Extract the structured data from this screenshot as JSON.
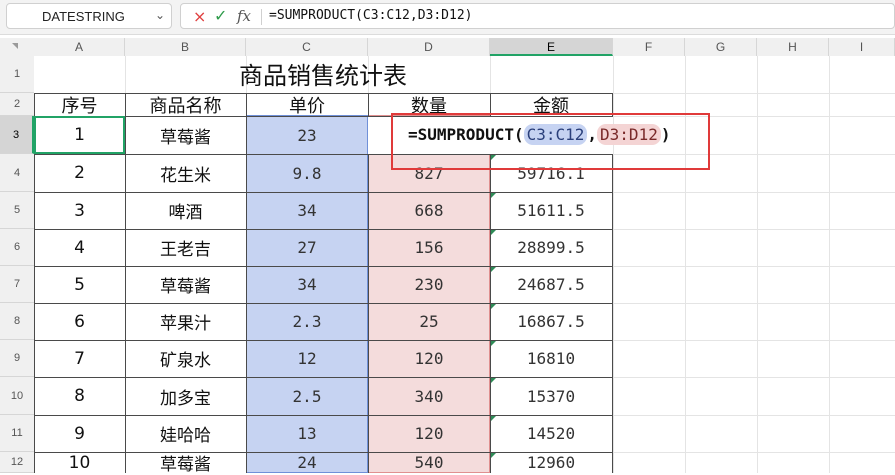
{
  "name_box": {
    "value": "DATESTRING",
    "chevron": "chevron-down-icon"
  },
  "formula_bar": {
    "cancel_icon": "×",
    "accept_icon": "✓",
    "function_icon": "fx",
    "content": "=SUMPRODUCT(C3:C12,D3:D12)"
  },
  "columns": [
    "A",
    "B",
    "C",
    "D",
    "E",
    "F",
    "G",
    "H",
    "I"
  ],
  "rows": [
    "1",
    "2",
    "3",
    "4",
    "5",
    "6",
    "7",
    "8",
    "9",
    "10",
    "11",
    "12"
  ],
  "sheet": {
    "title": "商品销售统计表",
    "headers": [
      "序号",
      "商品名称",
      "单价",
      "数量",
      "金额"
    ],
    "data": [
      [
        "1",
        "草莓酱",
        "23",
        "",
        ""
      ],
      [
        "2",
        "花生米",
        "9.8",
        "827",
        "59716.1"
      ],
      [
        "3",
        "啤酒",
        "34",
        "668",
        "51611.5"
      ],
      [
        "4",
        "王老吉",
        "27",
        "156",
        "28899.5"
      ],
      [
        "5",
        "草莓酱",
        "34",
        "230",
        "24687.5"
      ],
      [
        "6",
        "苹果汁",
        "2.3",
        "25",
        "16867.5"
      ],
      [
        "7",
        "矿泉水",
        "12",
        "120",
        "16810"
      ],
      [
        "8",
        "加多宝",
        "2.5",
        "340",
        "15370"
      ],
      [
        "9",
        "娃哈哈",
        "13",
        "120",
        "14520"
      ],
      [
        "10",
        "草莓酱",
        "24",
        "540",
        "12960"
      ]
    ]
  },
  "editing_formula": {
    "prefix": "=SUMPRODUCT(",
    "arg1": "C3:C12",
    "comma": ",",
    "arg2": "D3:D12",
    "suffix": ")"
  },
  "colors": {
    "accent_green": "#21a366",
    "range_blue": "#c6d3f2",
    "range_red": "#f4dcdc",
    "annotation_red": "#e03a3a"
  }
}
